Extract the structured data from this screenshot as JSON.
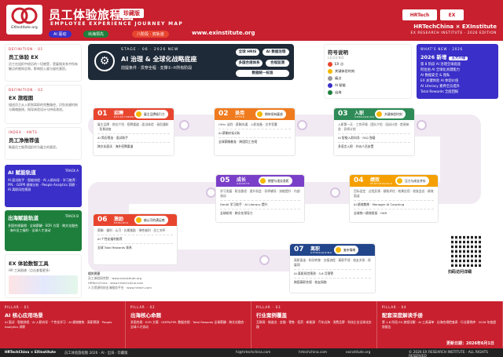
{
  "header": {
    "logo_text": "EXInstitute.org",
    "title": "员工体验旅程图",
    "badge": "珍藏版",
    "subtitle": "EMPLOYEE EXPERIENCE JOURNEY MAP",
    "pills": [
      "AI 驱动",
      "出海领先",
      "八阶段 · 双轨道"
    ],
    "url": "www.exinstitute.org",
    "brand": "HRTechChina × EXInstitute",
    "research": "EX RESEARCH INSTITUTE · 2026 EDITION",
    "logo_a": "HRTech",
    "logo_b": "EX"
  },
  "left": {
    "def1": {
      "tag": "DEFINITION · 01",
      "title": "员工体验 EX",
      "body": "员工在组织中经历的一切感受，是雇佣关系中所有触点的感知总和，影响投入度与留任意愿。"
    },
    "def2": {
      "tag": "DEFINITION · 02",
      "title": "EX 旅程图",
      "body": "描述员工从入职到离职的完整路径，识别关键时刻与情绪曲线，指导体验设计与持续改进。"
    },
    "def3": {
      "tag": "INDEX · ANTS",
      "title": "员工净推荐值",
      "body": "衡量员工推荐组织作为雇主的意愿。"
    },
    "trackA": {
      "tag": "TRACK A",
      "title": "AI 赋能轨道",
      "body": "AI 面试助手 · 智能排程 · AI 入职向导 · 学习推荐 · PPL · GOPR 绩效分析 · People Analytics 洞察 · AI 离职风险预测"
    },
    "trackB": {
      "tag": "TRACK B",
      "title": "出海赋能轨道",
      "body": "多国合规雇佣 · 全球薪酬 · EOR 方案 · 跨文化融合 · 海外员工福利 · 全球人才流动"
    },
    "tools": {
      "title": "EX 体验数智工具",
      "sub": "HR 工具图谱（点击查看更多）"
    }
  },
  "hero": {
    "kicker": "STAGE · 06 · 2026 NEW",
    "title": "AI 治理 & 全球化战略底座",
    "sub": "前提条件 · 贯穿全程 · 支撑①-⑦所有阶段",
    "btns": [
      "全球 HRIS",
      "AI 数据治理",
      "多国合规体系",
      "合规监测",
      "数据统一标准"
    ]
  },
  "legend": {
    "title": "符号说明",
    "tag": "LEGEND",
    "items": [
      "EX 点",
      "关键体验时刻",
      "痛点",
      "AI 赋能",
      "出海"
    ]
  },
  "whatsnew": {
    "tag": "WHAT'S NEW · 2026",
    "title": "2026 新增",
    "badge": "五大升级",
    "lines": [
      "第 8 阶段 AI 治理全球底座",
      "阿拉伯 AI 全球化关键能力",
      "AI 数据安全 & 隐私",
      "EX 关键体验 AI 体验价值",
      "AI Literacy 素养全员提升",
      "Total Rewards 全面回报"
    ]
  },
  "stages": [
    {
      "num": "01",
      "name": "招聘",
      "en": "RECRUITMENT",
      "emotion": "雇主品牌吸引力",
      "body": "雇主品牌 · 岗位介绍 · 招聘渠道 · 面试体验 · 录用通知 · 背景调查",
      "ai": "AI 简历筛选 · 面试助手",
      "ai2": "跨文化面试 · 海外招聘渠道"
    },
    {
      "num": "02",
      "name": "录用",
      "en": "OFFER",
      "emotion": "期待但有疑虑",
      "body": "Offer 谈判 · 薪酬沟通 · 入职准备 · 文件签署",
      "ai": "AI 薪酬对标分析",
      "ai2": "全球薪酬基准 · 跨国用工合规"
    },
    {
      "num": "03",
      "name": "入职",
      "en": "ONBOARDING",
      "emotion": "关键体验时刻",
      "body": "入职第一天 · 工作环境 · 团队介绍 · 培训计划 · 首周体验 · 导师计划",
      "ai": "AI 智能入职向导 · FAQ 答疑",
      "ai2": "多语言入职 · 外派人员安置"
    },
    {
      "num": "04",
      "name": "绩效",
      "en": "PERFORMANCE",
      "emotion": "压力与成长并存",
      "body": "目标设定 · 过程反馈 · 绩效评估 · 结果应用 · 校准会议 · 绩效面谈",
      "ai": "AI 绩效教练 · Manager AI Coaching",
      "ai2": "全球统一绩效框架 · OKR"
    },
    {
      "num": "05",
      "name": "成长",
      "en": "GROWTH",
      "emotion": "期望与现实差距",
      "body": "学习发展 · 职业路径 · 晋升机会 · 导师辅导 · 技能提升 · 内部流动",
      "ai": "GenAI 学习助手 · AI Literacy 提升",
      "ai2": "全球轮岗 · 跨文化领导力"
    },
    {
      "num": "06",
      "name": "激励",
      "en": "REWARDS",
      "emotion": "被认可的满足感",
      "body": "薪酬 · 福利 · 认可 · 长期激励 · 弹性福利 · 员工关怀",
      "ai": "AI 个性化福利推荐",
      "ai2": "全球 Total Rewards 体系"
    },
    {
      "num": "07",
      "name": "离职",
      "en": "OFFBOARDING",
      "emotion": "复杂情绪",
      "body": "离职面谈 · 知识转移 · 交接流程 · 离职手续 · 校友关系 · 再雇佣",
      "ai": "AI 离职风险预测 · 3-6 月预警",
      "ai2": "跨国离职合规 · 校友网络"
    }
  ],
  "source": {
    "title": "相关资源",
    "lines": [
      "员工体验研究院 · www.exinstitute.org",
      "HRTechChina · www.hrtechchina.com",
      "人力资源科技出海服务平台 · www.hrtech.com"
    ]
  },
  "qr_label": "扫码访问详细",
  "pillars": [
    {
      "tag": "PILLAR · 01",
      "title": "AI 核心应用场景",
      "body": "AI 面试 · 智能排程 · AI 入职向导 · 个性化学习 · AI 绩效教练 · 离职预测 · People Analytics 洞察"
    },
    {
      "tag": "PILLAR · 02",
      "title": "出海核心命题",
      "body": "多国合规 · EOR 方案 · GDPR/PIPL 数据合规 · Total Rewards 全球薪酬 · 跨文化融合 · 全球人才流动"
    },
    {
      "tag": "PILLAR · 03",
      "title": "行业案例覆盖",
      "body": "互联网 · 制造业 · 金融 · 零售 · 医药 · 新能源 · 汽车出海 · 消费品牌 · 科技企业全球化实践"
    },
    {
      "tag": "PILLAR · 04",
      "title": "配套深度解读手册",
      "body": "第 1-8 阶段 EX 旅程详解 · AI 工具清单 · 出海合规检查表 · 行业案例库 · 2026 年度趋势报告"
    }
  ],
  "footer": {
    "brand": "HRTechChina × EXInstitute",
    "title": "员工体验旅程图 2026 · AI · 出海 · 珍藏版",
    "email": "hi@hrtechchina.com",
    "site1": "hrtechchina.com",
    "site2": "exinstitute.org",
    "copy": "© 2026 EX RESEARCH INSTITUTE · ALL RIGHTS RESERVED"
  },
  "updated": "更新日期：2026年6月1日",
  "colors": {
    "brand": "#c8202e",
    "dark": "#1f2a38",
    "ai": "#3a2fc8",
    "s01": "#e8452f",
    "s02": "#f07b1e",
    "s03": "#2e8b57",
    "s04": "#f5a000",
    "s05": "#7a3fc8",
    "s06": "#e8452f",
    "s07": "#22468c"
  }
}
